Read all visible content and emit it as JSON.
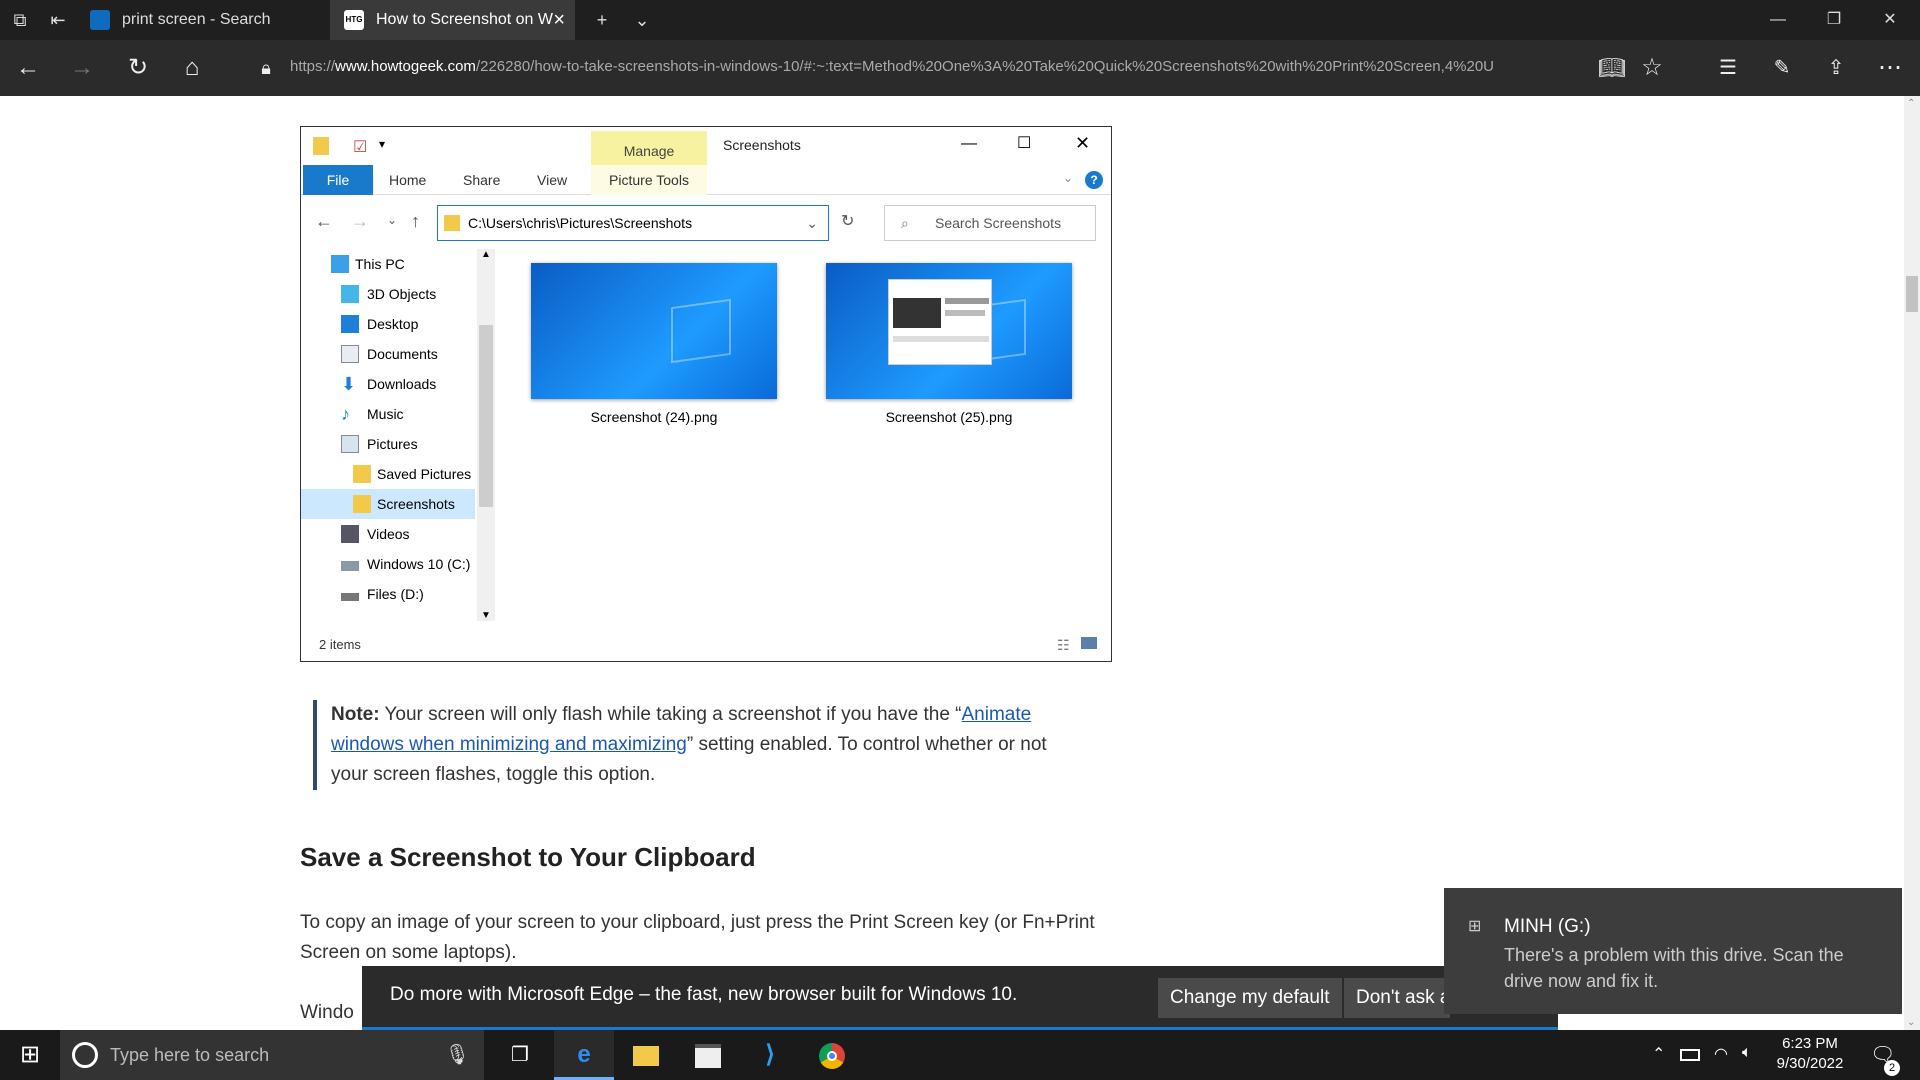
{
  "browser": {
    "tabs": [
      {
        "label": "print screen - Search"
      },
      {
        "label": "How to Screenshot on W",
        "fav": "HTG"
      }
    ],
    "url_prefix": "https://",
    "url_domain": "www.howtogeek.com",
    "url_rest": "/226280/how-to-take-screenshots-in-windows-10/#:~:text=Method%20One%3A%20Take%20Quick%20Screenshots%20with%20Print%20Screen,4%20U"
  },
  "explorer": {
    "manage": "Manage",
    "title": "Screenshots",
    "ribbon_tabs": [
      "File",
      "Home",
      "Share",
      "View",
      "Picture Tools"
    ],
    "path": "C:\\Users\\chris\\Pictures\\Screenshots",
    "search_placeholder": "Search Screenshots",
    "tree": [
      {
        "label": "This PC"
      },
      {
        "label": "3D Objects"
      },
      {
        "label": "Desktop"
      },
      {
        "label": "Documents"
      },
      {
        "label": "Downloads"
      },
      {
        "label": "Music"
      },
      {
        "label": "Pictures"
      },
      {
        "label": "Saved Pictures"
      },
      {
        "label": "Screenshots"
      },
      {
        "label": "Videos"
      },
      {
        "label": "Windows 10 (C:)"
      },
      {
        "label": "Files (D:)"
      }
    ],
    "files": [
      {
        "name": "Screenshot (24).png"
      },
      {
        "name": "Screenshot (25).png"
      }
    ],
    "status": "2 items"
  },
  "article": {
    "note_label": "Note:",
    "note_text1": " Your screen will only flash while taking a screenshot if you have the “",
    "note_link": "Animate windows when minimizing and maximizing",
    "note_text2": "” setting enabled. To control whether or not your screen flashes, toggle this option.",
    "heading": "Save a Screenshot to Your Clipboard",
    "para": "To copy an image of your screen to your clipboard, just press the Print Screen key (or Fn+Print Screen on some laptops).",
    "para2_start": "Windo"
  },
  "edge_banner": {
    "message": "Do more with Microsoft Edge – the fast, new browser built for Windows 10.",
    "change_default": "Change my default",
    "dont_ask": "Don't ask a"
  },
  "toast": {
    "title": "MINH (G:)",
    "body": "There's a problem with this drive.  Scan the drive now and fix it."
  },
  "taskbar": {
    "search_placeholder": "Type here to search",
    "time": "6:23 PM",
    "date": "9/30/2022",
    "notifications": "2"
  }
}
